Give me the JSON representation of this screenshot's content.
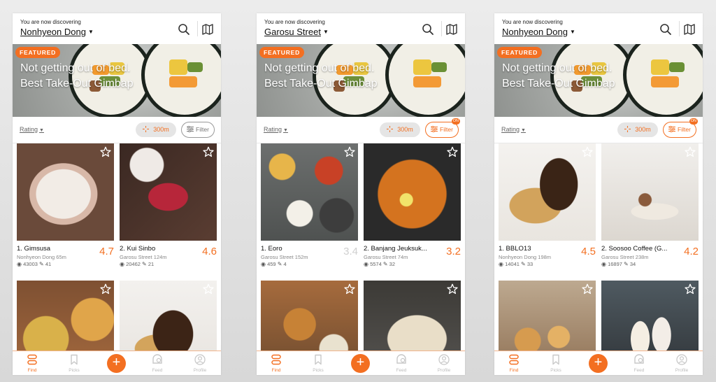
{
  "colors": {
    "accent": "#f36f21",
    "background": "#e2e2e2"
  },
  "screens": [
    {
      "header": {
        "subtitle": "You are now discovering",
        "location": "Nonhyeon Dong"
      },
      "banner": {
        "badge": "FEATURED",
        "line1": "Not getting out of bed.",
        "line2": "Best Take-Out Gimbap"
      },
      "controls": {
        "sort": "Rating",
        "distance": "300m",
        "filter": "Filter",
        "filter_on_badge": ""
      },
      "cards": [
        {
          "name": "1. Gimsusa",
          "place": "Nonhyeon Dong 65m",
          "views": "43003",
          "posts": "41",
          "score": "4.7"
        },
        {
          "name": "2. Kui Sinbo",
          "place": "Garosu Street 124m",
          "views": "20462",
          "posts": "21",
          "score": "4.6"
        },
        {
          "name": "",
          "place": "",
          "views": "",
          "posts": "",
          "score": ""
        },
        {
          "name": "",
          "place": "",
          "views": "",
          "posts": "",
          "score": ""
        }
      ],
      "nav": [
        "Find",
        "Picks",
        "Feed",
        "Profile"
      ]
    },
    {
      "header": {
        "subtitle": "You are now discovering",
        "location": "Garosu Street"
      },
      "banner": {
        "badge": "FEATURED",
        "line1": "Not getting out of bed.",
        "line2": "Best Take-Out Gimbap"
      },
      "controls": {
        "sort": "Rating",
        "distance": "300m",
        "filter": "Filter",
        "filter_on_badge": "ON"
      },
      "cards": [
        {
          "name": "1. Eoro",
          "place": "Garosu Street 152m",
          "views": "459",
          "posts": "4",
          "score": "3.4"
        },
        {
          "name": "2. Banjang Jeuksuk...",
          "place": "Garosu Street 74m",
          "views": "5574",
          "posts": "32",
          "score": "3.2"
        },
        {
          "name": "",
          "place": "",
          "views": "",
          "posts": "",
          "score": ""
        },
        {
          "name": "",
          "place": "",
          "views": "",
          "posts": "",
          "score": ""
        }
      ],
      "nav": [
        "Find",
        "Picks",
        "Feed",
        "Profile"
      ]
    },
    {
      "header": {
        "subtitle": "You are now discovering",
        "location": "Nonhyeon Dong"
      },
      "banner": {
        "badge": "FEATURED",
        "line1": "Not getting out of bed.",
        "line2": "Best Take-Out Gimbap"
      },
      "controls": {
        "sort": "Rating",
        "distance": "300m",
        "filter": "Filter",
        "filter_on_badge": "ON"
      },
      "cards": [
        {
          "name": "1. BBLO13",
          "place": "Nonhyeon Dong 198m",
          "views": "14041",
          "posts": "33",
          "score": "4.5"
        },
        {
          "name": "2. Soosoo Coffee (G...",
          "place": "Garosu Street 238m",
          "views": "16897",
          "posts": "34",
          "score": "4.2"
        },
        {
          "name": "",
          "place": "",
          "views": "",
          "posts": "",
          "score": ""
        },
        {
          "name": "",
          "place": "",
          "views": "",
          "posts": "",
          "score": ""
        }
      ],
      "nav": [
        "Find",
        "Picks",
        "Feed",
        "Profile"
      ]
    }
  ]
}
